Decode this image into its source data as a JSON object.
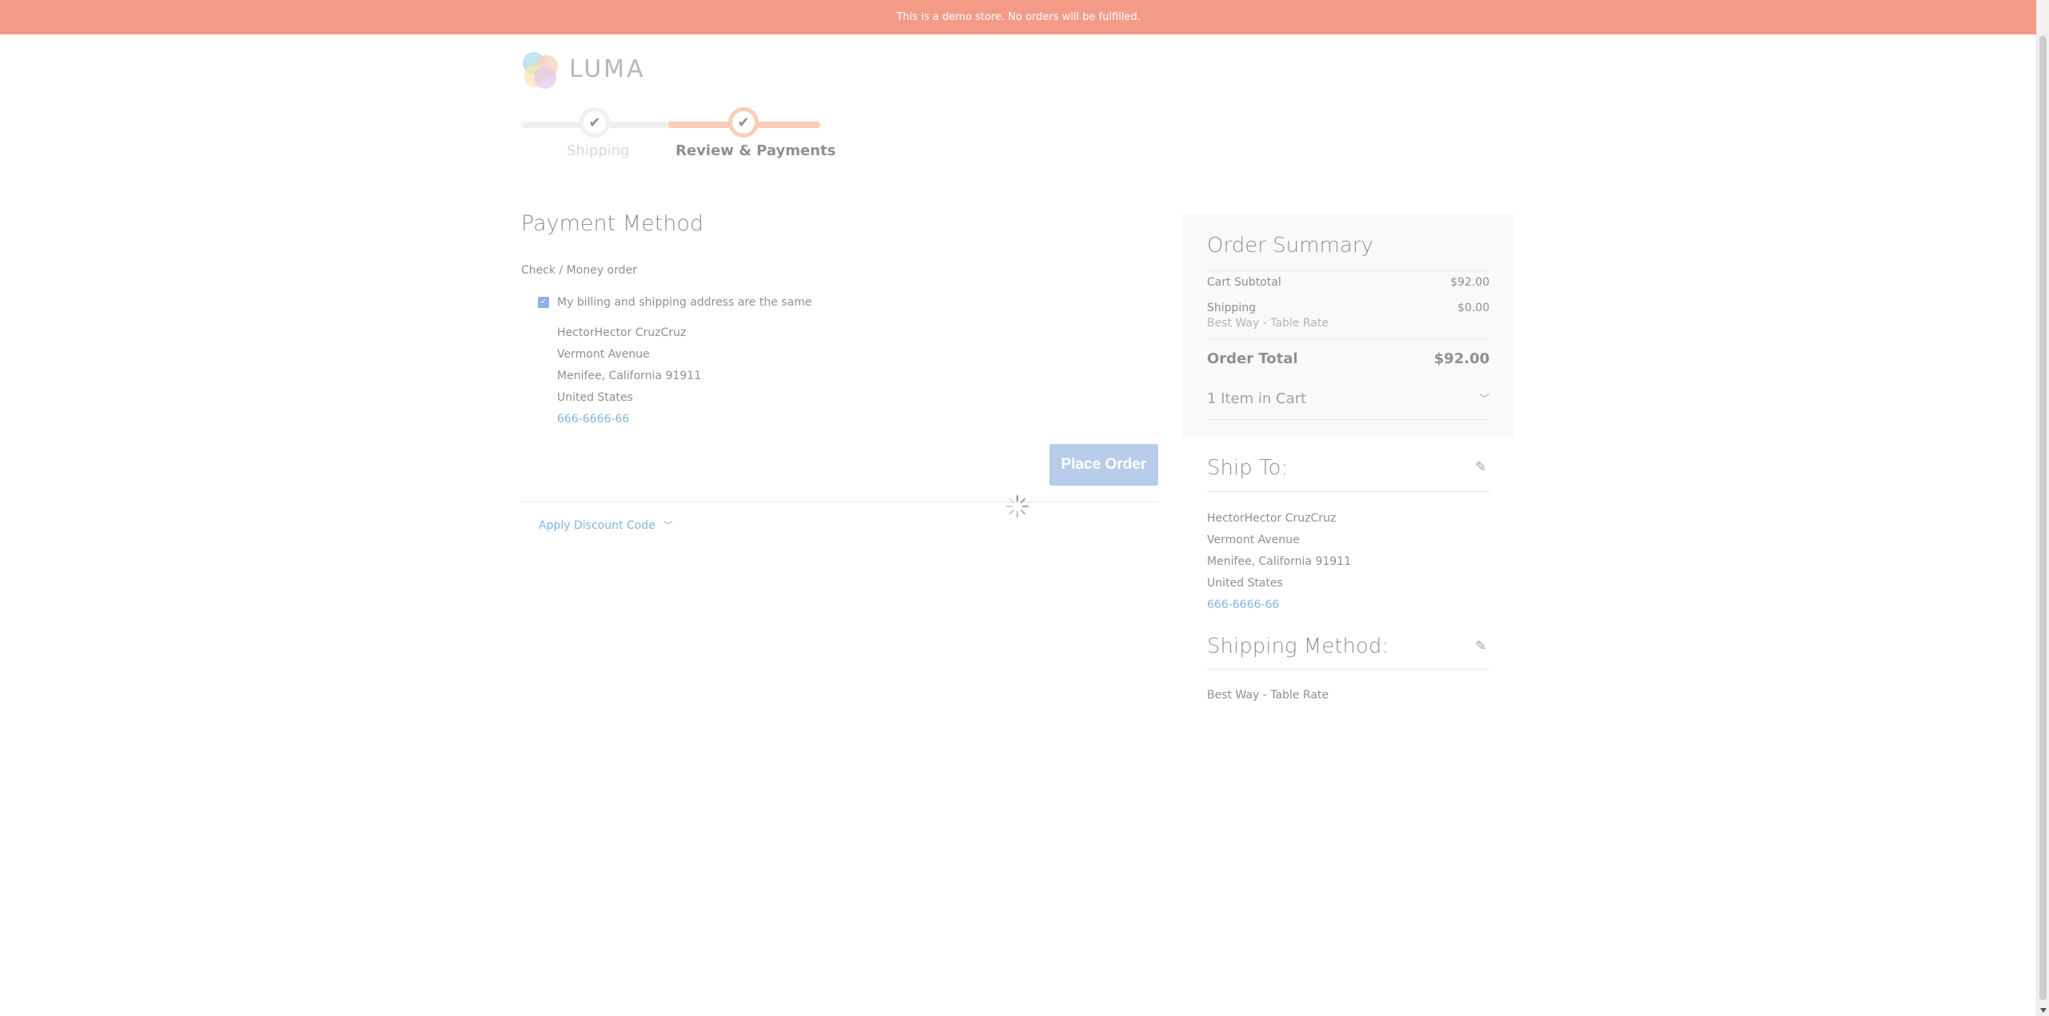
{
  "banner": {
    "text": "This is a demo store. No orders will be fulfilled."
  },
  "logo": {
    "text": "LUMA"
  },
  "progress": {
    "steps": [
      {
        "label": "Shipping"
      },
      {
        "label": "Review & Payments"
      }
    ]
  },
  "payment": {
    "title": "Payment Method",
    "method": "Check / Money order",
    "same_address_label": "My billing and shipping address are the same",
    "same_address_checked": true,
    "address": {
      "name": "HectorHector CruzCruz",
      "street": "Vermont Avenue",
      "city_line": "Menifee, California 91911",
      "country": "United States",
      "phone": "666-6666-66"
    },
    "place_order_label": "Place Order",
    "discount_label": "Apply Discount Code"
  },
  "summary": {
    "title": "Order Summary",
    "cart_subtotal_label": "Cart Subtotal",
    "cart_subtotal_value": "$92.00",
    "shipping_label": "Shipping",
    "shipping_value": "$0.00",
    "shipping_method": "Best Way - Table Rate",
    "order_total_label": "Order Total",
    "order_total_value": "$92.00",
    "items_in_cart": "1 Item in Cart"
  },
  "ship_to": {
    "title": "Ship To:",
    "name": "HectorHector CruzCruz",
    "street": "Vermont Avenue",
    "city_line": "Menifee, California 91911",
    "country": "United States",
    "phone": "666-6666-66"
  },
  "shipping_method": {
    "title": "Shipping Method:",
    "value": "Best Way - Table Rate"
  },
  "colors": {
    "banner": "#f39b87",
    "accent": "#f2a67f",
    "button": "#7da5d8",
    "link": "#1979c3"
  }
}
